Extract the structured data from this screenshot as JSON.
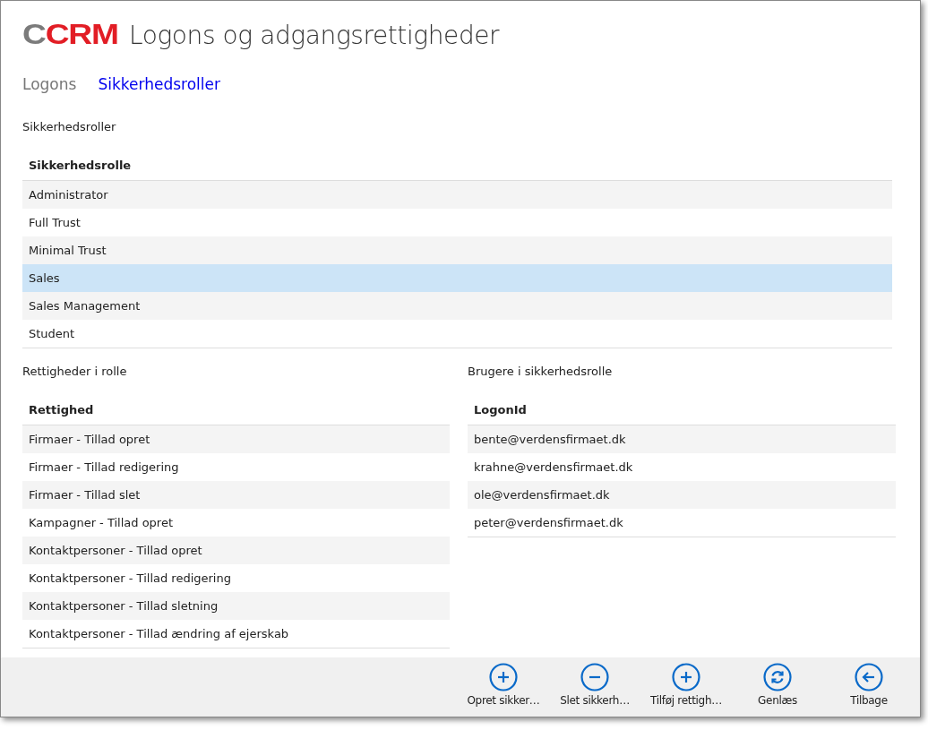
{
  "logo": {
    "prefix": "C",
    "name": "CRM"
  },
  "title": "Logons og adgangsrettigheder",
  "tabs": [
    {
      "label": "Logons",
      "selected": false
    },
    {
      "label": "Sikkerhedsroller",
      "selected": true
    }
  ],
  "roles": {
    "heading": "Sikkerhedsroller",
    "columns": [
      "Sikkerhedsrolle"
    ],
    "rows": [
      {
        "cells": [
          "Administrator"
        ],
        "selected": false
      },
      {
        "cells": [
          "Full Trust"
        ],
        "selected": false
      },
      {
        "cells": [
          "Minimal Trust"
        ],
        "selected": false
      },
      {
        "cells": [
          "Sales"
        ],
        "selected": true
      },
      {
        "cells": [
          "Sales Management"
        ],
        "selected": false
      },
      {
        "cells": [
          "Student"
        ],
        "selected": false
      }
    ]
  },
  "rights": {
    "heading": "Rettigheder i rolle",
    "columns": [
      "Rettighed"
    ],
    "rows": [
      {
        "cells": [
          "Firmaer - Tillad opret"
        ],
        "selected": false
      },
      {
        "cells": [
          "Firmaer - Tillad redigering"
        ],
        "selected": false
      },
      {
        "cells": [
          "Firmaer - Tillad slet"
        ],
        "selected": false
      },
      {
        "cells": [
          "Kampagner - Tillad opret"
        ],
        "selected": false
      },
      {
        "cells": [
          "Kontaktpersoner - Tillad opret"
        ],
        "selected": false
      },
      {
        "cells": [
          "Kontaktpersoner - Tillad redigering"
        ],
        "selected": false
      },
      {
        "cells": [
          "Kontaktpersoner - Tillad sletning"
        ],
        "selected": false
      },
      {
        "cells": [
          "Kontaktpersoner - Tillad ændring af ejerskab"
        ],
        "selected": false
      }
    ]
  },
  "users": {
    "heading": "Brugere i sikkerhedsrolle",
    "columns": [
      "LogonId"
    ],
    "rows": [
      {
        "cells": [
          "bente@verdensfirmaet.dk"
        ],
        "selected": false
      },
      {
        "cells": [
          "krahne@verdensfirmaet.dk"
        ],
        "selected": false
      },
      {
        "cells": [
          "ole@verdensfirmaet.dk"
        ],
        "selected": false
      },
      {
        "cells": [
          "peter@verdensfirmaet.dk"
        ],
        "selected": false
      }
    ]
  },
  "toolbar": [
    {
      "kind": "add",
      "label": "Opret sikker…"
    },
    {
      "kind": "remove",
      "label": "Slet sikkerh…"
    },
    {
      "kind": "add",
      "label": "Tilføj rettigh…"
    },
    {
      "kind": "refresh",
      "label": "Genlæs"
    },
    {
      "kind": "back",
      "label": "Tilbage"
    }
  ]
}
